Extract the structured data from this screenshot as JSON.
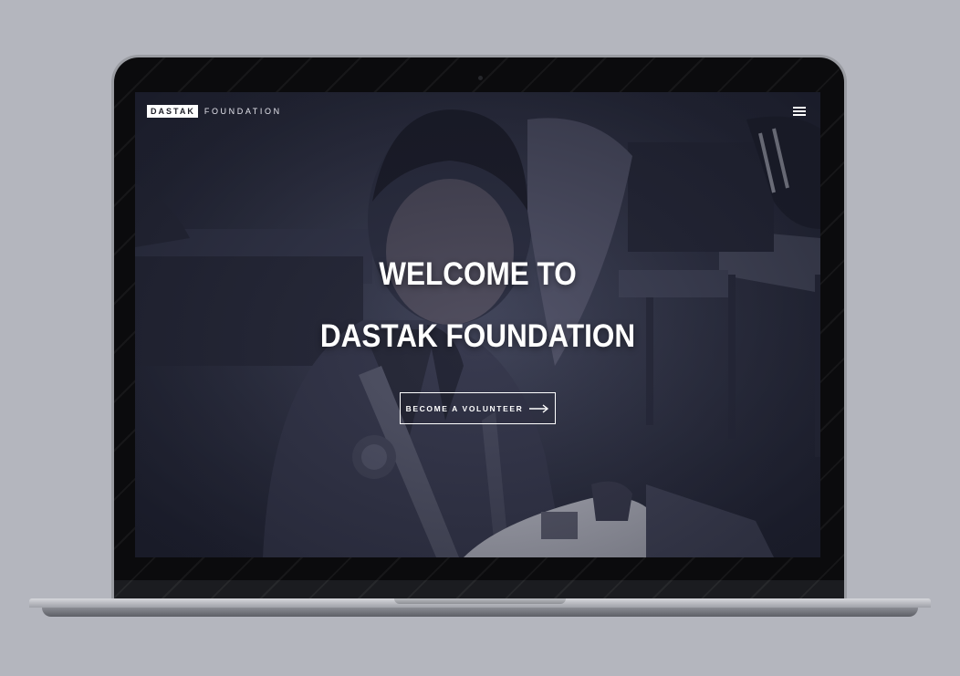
{
  "site": {
    "brand_box": "DASTAK",
    "brand_word": "FOUNDATION"
  },
  "hero": {
    "line1": "WELCOME TO",
    "line2": "DASTAK FOUNDATION"
  },
  "cta": {
    "label": "BECOME A VOLUNTEER"
  },
  "icons": {
    "menu": "hamburger-menu-icon",
    "arrow": "arrow-right-icon"
  },
  "colors": {
    "backdrop": "#b4b6be",
    "overlay": "#2c2f3f",
    "text": "#ffffff"
  }
}
